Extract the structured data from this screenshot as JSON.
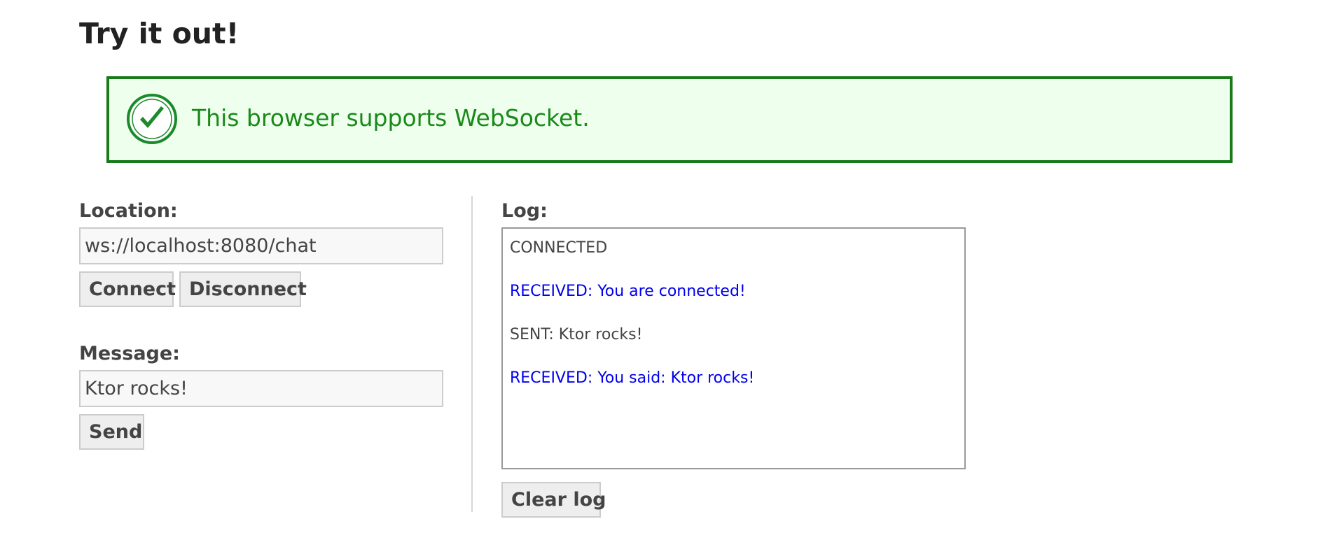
{
  "heading": "Try it out!",
  "banner": {
    "text": "This browser supports WebSocket.",
    "icon": "check-circle-icon",
    "border_color": "#1a7a1a",
    "background_color": "#eeffee",
    "text_color": "#198a19"
  },
  "location": {
    "label": "Location:",
    "value": "ws://localhost:8080/chat"
  },
  "connect_button": "Connect",
  "disconnect_button": "Disconnect",
  "message": {
    "label": "Message:",
    "value": "Ktor rocks!"
  },
  "send_button": "Send",
  "log": {
    "label": "Log:",
    "entries": [
      {
        "text": "CONNECTED",
        "type": "status",
        "color": "#444444"
      },
      {
        "text": "RECEIVED: You are connected!",
        "type": "received",
        "color": "#0000ee"
      },
      {
        "text": "SENT: Ktor rocks!",
        "type": "sent",
        "color": "#444444"
      },
      {
        "text": "RECEIVED: You said: Ktor rocks!",
        "type": "received",
        "color": "#0000ee"
      }
    ],
    "clear_button": "Clear log"
  }
}
